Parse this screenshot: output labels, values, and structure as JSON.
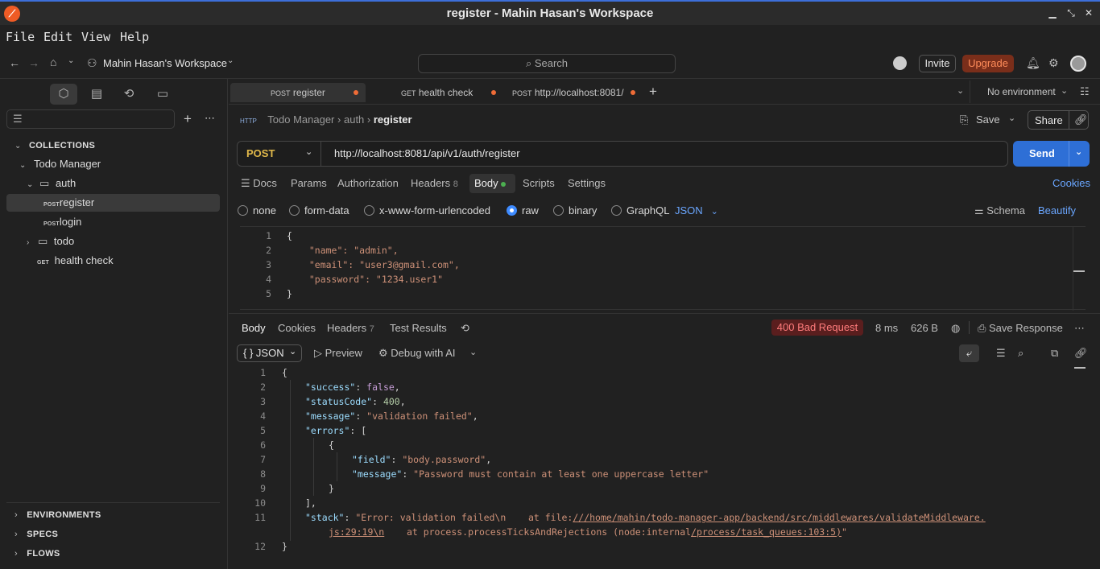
{
  "window": {
    "title": "register - Mahin Hasan's Workspace"
  },
  "menu": [
    "File",
    "Edit",
    "View",
    "Help"
  ],
  "toolbar": {
    "workspace": "Mahin Hasan's Workspace",
    "search_placeholder": "Search",
    "invite": "Invite",
    "upgrade": "Upgrade"
  },
  "sidebar": {
    "collections_label": "COLLECTIONS",
    "tree": {
      "collection": "Todo Manager",
      "folder_auth": "auth",
      "req_register": {
        "method": "POST",
        "name": "register"
      },
      "req_login": {
        "method": "POST",
        "name": "login"
      },
      "folder_todo": "todo",
      "req_health": {
        "method": "GET",
        "name": "health check"
      }
    },
    "environments": "ENVIRONMENTS",
    "specs": "SPECS",
    "flows": "FLOWS"
  },
  "tabs": [
    {
      "method": "POST",
      "name": "register"
    },
    {
      "method": "GET",
      "name": "health check"
    },
    {
      "method": "POST",
      "name": "http://localhost:8081/"
    }
  ],
  "environment": "No environment",
  "breadcrumb": {
    "collection": "Todo Manager",
    "folder": "auth",
    "request": "register"
  },
  "actions": {
    "save": "Save",
    "share": "Share"
  },
  "request": {
    "method": "POST",
    "url": "http://localhost:8081/api/v1/auth/register",
    "send": "Send",
    "subtabs": {
      "docs": "Docs",
      "params": "Params",
      "authorization": "Authorization",
      "headers": "Headers",
      "headers_count": "8",
      "body": "Body",
      "scripts": "Scripts",
      "settings": "Settings"
    },
    "cookies": "Cookies",
    "body_types": {
      "none": "none",
      "form_data": "form-data",
      "urlencoded": "x-www-form-urlencoded",
      "raw": "raw",
      "binary": "binary",
      "graphql": "GraphQL"
    },
    "format": "JSON",
    "schema": "Schema",
    "beautify": "Beautify",
    "body_lines": [
      "{",
      "  \"name\": \"admin\",",
      "  \"email\": \"user3@gmail.com\",",
      "  \"password\": \"1234.user1\"",
      "}"
    ]
  },
  "response": {
    "tabs": {
      "body": "Body",
      "cookies": "Cookies",
      "headers": "Headers",
      "headers_count": "7",
      "test_results": "Test Results"
    },
    "status": "400 Bad Request",
    "time": "8 ms",
    "size": "626 B",
    "save_response": "Save Response",
    "format": "JSON",
    "preview": "Preview",
    "debug": "Debug with AI",
    "body": {
      "success_key": "\"success\"",
      "success_val": "false",
      "status_key": "\"statusCode\"",
      "status_val": "400",
      "message_key": "\"message\"",
      "message_val": "\"validation failed\"",
      "errors_key": "\"errors\"",
      "field_key": "\"field\"",
      "field_val": "\"body.password\"",
      "err_message_key": "\"message\"",
      "err_message_val": "\"Password must contain at least one uppercase letter\"",
      "stack_key": "\"stack\"",
      "stack_1": "\"Error: validation failed\\n    at file:",
      "stack_1_link": "///home/mahin/todo-manager-app/backend/src/middlewares/validateMiddleware.",
      "stack_2_link": "js:29:19\\n",
      "stack_2": "    at process.processTicksAndRejections (node:internal",
      "stack_2_link2": "/process/task_queues:103:5)",
      "stack_2_end": "\""
    }
  }
}
